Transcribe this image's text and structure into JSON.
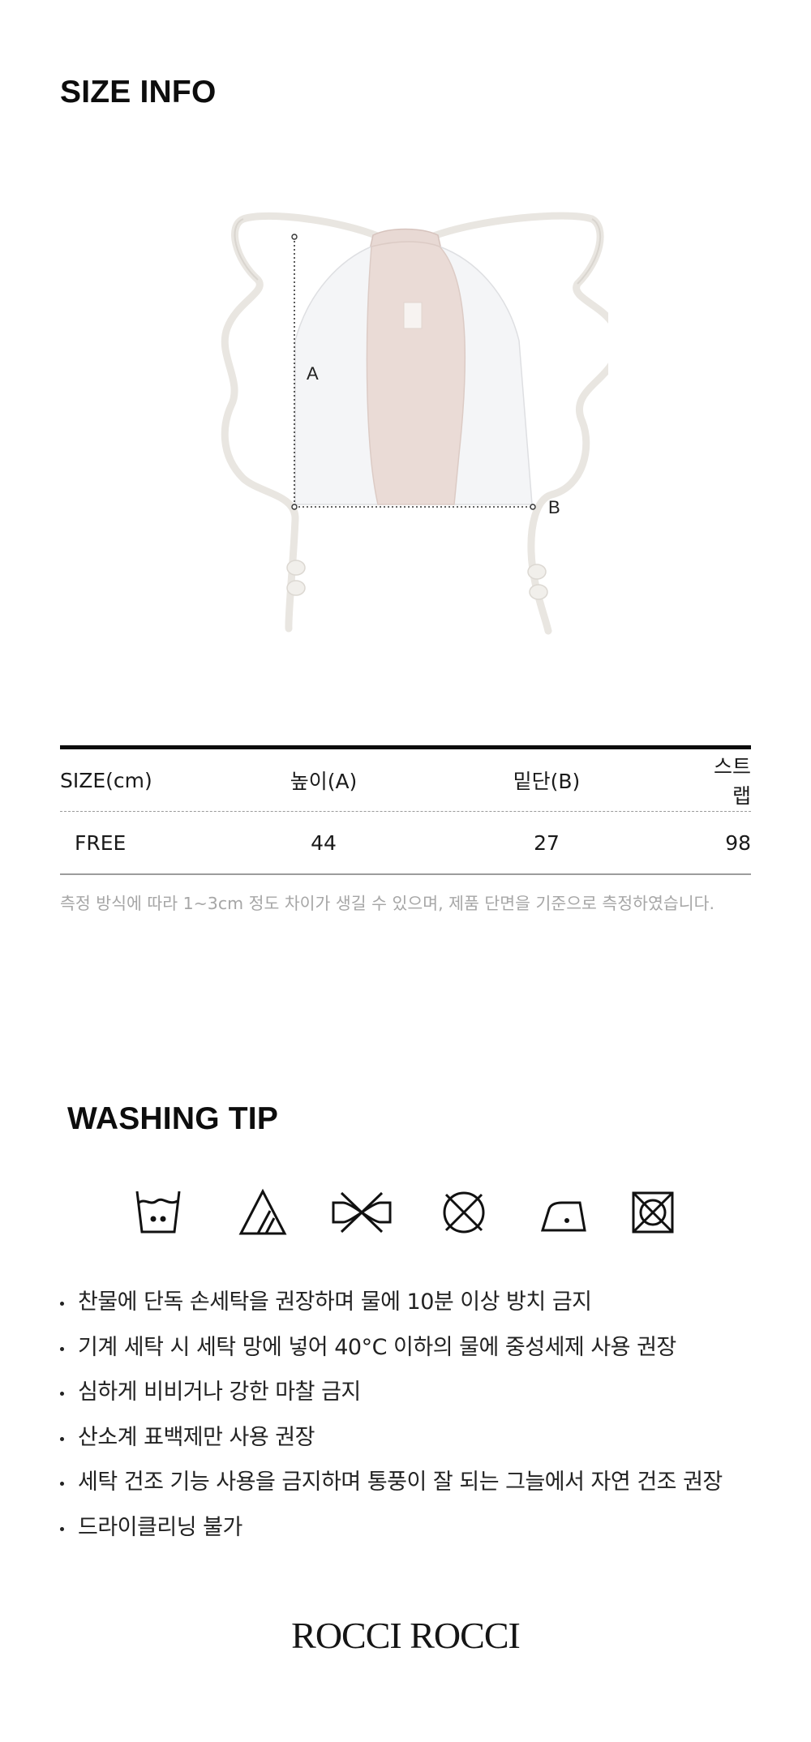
{
  "size_info": {
    "title": "SIZE INFO",
    "labels": {
      "a": "A",
      "b": "B"
    },
    "table": {
      "headers": [
        "SIZE(cm)",
        "높이(A)",
        "밑단(B)",
        "스트랩"
      ],
      "rows": [
        [
          "FREE",
          "44",
          "27",
          "98"
        ]
      ]
    },
    "note": "측정 방식에 따라 1~3cm 정도 차이가 생길 수 있으며, 제품 단면을 기준으로 측정하였습니다."
  },
  "washing_tip": {
    "title": "WASHING TIP",
    "icons": [
      "hand-wash-30-icon",
      "chlorine-bleach-only-icon",
      "do-not-wring-icon",
      "do-not-tumble-dry-icon",
      "iron-low-heat-icon",
      "do-not-dry-clean-icon"
    ],
    "tips": [
      "찬물에 단독 손세탁을 권장하며 물에 10분 이상 방치 금지",
      "기계 세탁 시 세탁 망에 넣어 40°C 이하의 물에 중성세제 사용 권장",
      "심하게 비비거나 강한 마찰 금지",
      "산소계 표백제만 사용 권장",
      "세탁 건조 기능 사용을 금지하며 통풍이 잘 되는 그늘에서 자연 건조 권장",
      "드라이클리닝 불가"
    ]
  },
  "brand": "ROCCI ROCCI",
  "colors": {
    "accent_pink": "#eadbd6",
    "panel_white": "#f3f4f6",
    "cord": "#f4f2ee"
  }
}
